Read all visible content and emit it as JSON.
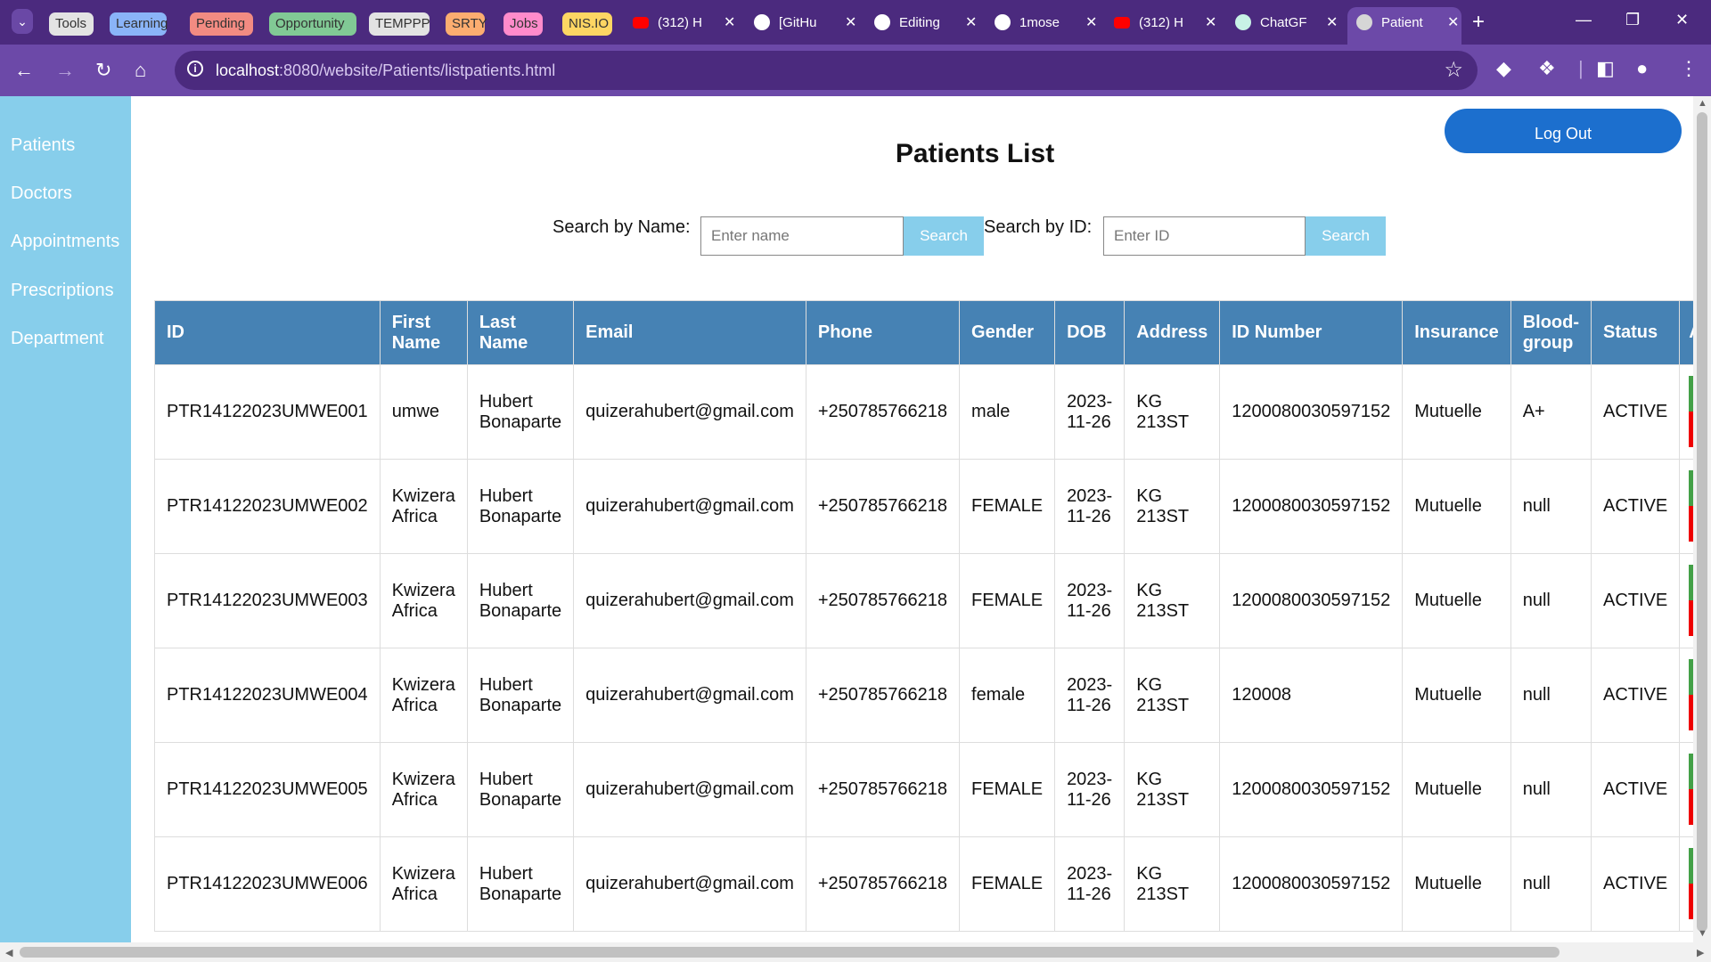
{
  "browser": {
    "tab_groups": [
      {
        "label": "Tools",
        "color": "#e3e3e3"
      },
      {
        "label": "Learning",
        "color": "#8ab4f8"
      },
      {
        "label": "Pending",
        "color": "#f28b82"
      },
      {
        "label": "Opportunity",
        "color": "#81c995"
      },
      {
        "label": "TEMPPP",
        "color": "#e3e3e3"
      },
      {
        "label": "SRTY",
        "color": "#fcad70"
      },
      {
        "label": "Jobs",
        "color": "#ff8bcb"
      },
      {
        "label": "NIS.IO",
        "color": "#fdd663"
      }
    ],
    "tabs": [
      {
        "title": "(312) H",
        "icon": "youtube-icon"
      },
      {
        "title": "[GitHu",
        "icon": "github-issue-icon"
      },
      {
        "title": "Editing",
        "icon": "github-icon"
      },
      {
        "title": "1mose",
        "icon": "github-icon"
      },
      {
        "title": "(312) H",
        "icon": "youtube-icon"
      },
      {
        "title": "ChatGF",
        "icon": "chatgpt-icon"
      },
      {
        "title": "Patient",
        "icon": "globe-icon",
        "active": true
      }
    ],
    "url_host": "localhost",
    "url_path": ":8080/website/Patients/listpatients.html"
  },
  "sidebar": {
    "items": [
      {
        "label": "Patients"
      },
      {
        "label": "Doctors"
      },
      {
        "label": "Appointments"
      },
      {
        "label": "Prescriptions"
      },
      {
        "label": "Department"
      }
    ]
  },
  "page": {
    "title": "Patients List",
    "logout_label": "Log Out",
    "search_name_label": "Search by Name:",
    "search_name_placeholder": "Enter name",
    "search_id_label": "Search by ID:",
    "search_id_placeholder": "Enter ID",
    "search_button_label": "Search"
  },
  "table": {
    "headers": [
      "ID",
      "First Name",
      "Last Name",
      "Email",
      "Phone",
      "Gender",
      "DOB",
      "Address",
      "ID Number",
      "Insurance",
      "Blood-group",
      "Status",
      "A"
    ],
    "rows": [
      [
        "PTR14122023UMWE001",
        "umwe",
        "Hubert Bonaparte",
        "quizerahubert@gmail.com",
        "+250785766218",
        "male",
        "2023-11-26",
        "KG 213ST",
        "1200080030597152",
        "Mutuelle",
        "A+",
        "ACTIVE"
      ],
      [
        "PTR14122023UMWE002",
        "Kwizera Africa",
        "Hubert Bonaparte",
        "quizerahubert@gmail.com",
        "+250785766218",
        "FEMALE",
        "2023-11-26",
        "KG 213ST",
        "1200080030597152",
        "Mutuelle",
        "null",
        "ACTIVE"
      ],
      [
        "PTR14122023UMWE003",
        "Kwizera Africa",
        "Hubert Bonaparte",
        "quizerahubert@gmail.com",
        "+250785766218",
        "FEMALE",
        "2023-11-26",
        "KG 213ST",
        "1200080030597152",
        "Mutuelle",
        "null",
        "ACTIVE"
      ],
      [
        "PTR14122023UMWE004",
        "Kwizera Africa",
        "Hubert Bonaparte",
        "quizerahubert@gmail.com",
        "+250785766218",
        "female",
        "2023-11-26",
        "KG 213ST",
        "120008",
        "Mutuelle",
        "null",
        "ACTIVE"
      ],
      [
        "PTR14122023UMWE005",
        "Kwizera Africa",
        "Hubert Bonaparte",
        "quizerahubert@gmail.com",
        "+250785766218",
        "FEMALE",
        "2023-11-26",
        "KG 213ST",
        "1200080030597152",
        "Mutuelle",
        "null",
        "ACTIVE"
      ],
      [
        "PTR14122023UMWE006",
        "Kwizera Africa",
        "Hubert Bonaparte",
        "quizerahubert@gmail.com",
        "+250785766218",
        "FEMALE",
        "2023-11-26",
        "KG 213ST",
        "1200080030597152",
        "Mutuelle",
        "null",
        "ACTIVE"
      ]
    ]
  },
  "colors": {
    "tabbar": "#4b2a7e",
    "toolbar": "#6c49a8",
    "sidebar": "#87ceeb",
    "table_header": "#4682b4",
    "logout": "#1c6fce",
    "search_button": "#87ceeb",
    "action_green": "#43a047",
    "action_red": "#ee0000"
  }
}
